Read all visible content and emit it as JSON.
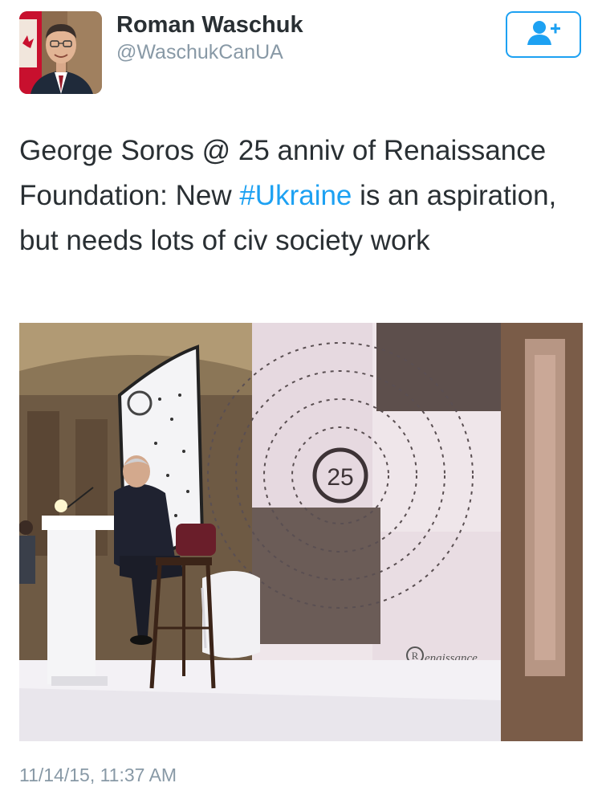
{
  "author": {
    "display_name": "Roman Waschuk",
    "handle": "@WaschukCanUA"
  },
  "follow_button": {
    "icon": "add-user-icon",
    "color": "#1da1f2"
  },
  "tweet": {
    "text_before": "George Soros @ 25 anniv of Renaissance Foundation: New ",
    "hashtag": "#Ukraine",
    "text_after": " is an aspiration, but needs lots of civ society work",
    "timestamp": "11/14/15, 11:37 AM"
  },
  "photo": {
    "backdrop_number": "25",
    "logo_text": "enaissance",
    "logo_initial": "R"
  },
  "colors": {
    "link": "#1da1f2",
    "secondary_text": "#8899a6",
    "primary_text": "#292f33"
  }
}
